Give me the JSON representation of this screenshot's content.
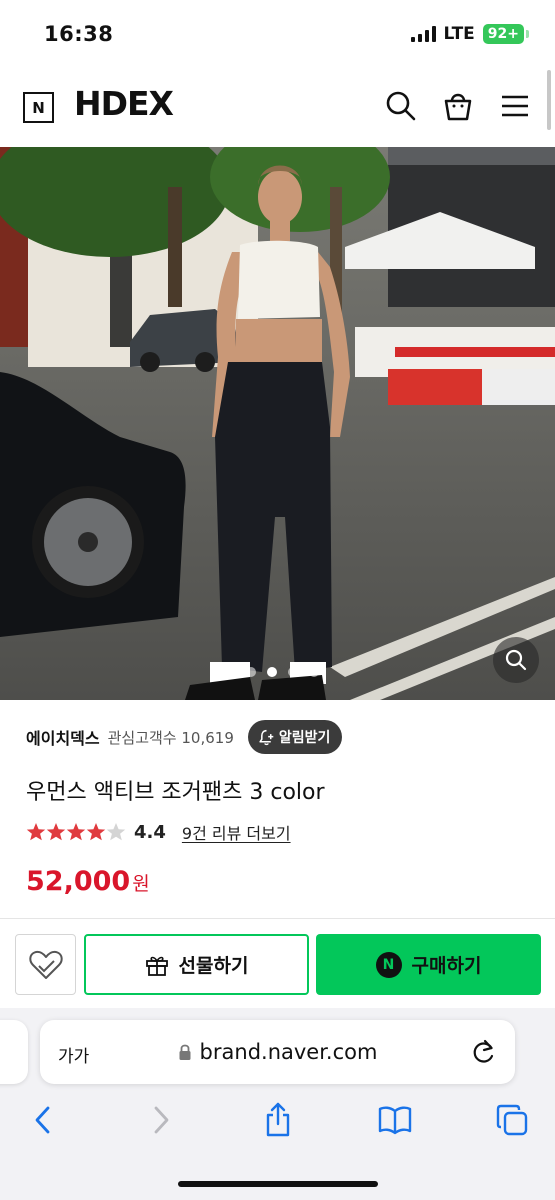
{
  "status_bar": {
    "time": "16:38",
    "network": "LTE",
    "battery": "92+"
  },
  "header": {
    "logo_letter": "N",
    "brand": "HDEX"
  },
  "hero": {
    "slide_count": 4,
    "active_slide": 1
  },
  "store": {
    "name": "에이치덱스",
    "fans_label": "관심고객수 10,619",
    "alarm_label": "알림받기"
  },
  "product": {
    "title": "우먼스 액티브 조거팬츠 3 color",
    "rating": "4.4",
    "rating_value": 4.4,
    "review_link": "9건 리뷰 더보기",
    "price": "52,000",
    "price_unit": "원"
  },
  "actions": {
    "gift_label": "선물하기",
    "buy_label": "구매하기",
    "buy_badge": "N"
  },
  "browser": {
    "text_size_label": "가가",
    "url": "brand.naver.com"
  },
  "colors": {
    "naver_green": "#03c75a",
    "price_red": "#d9162b",
    "star_red": "#e03a3e"
  }
}
